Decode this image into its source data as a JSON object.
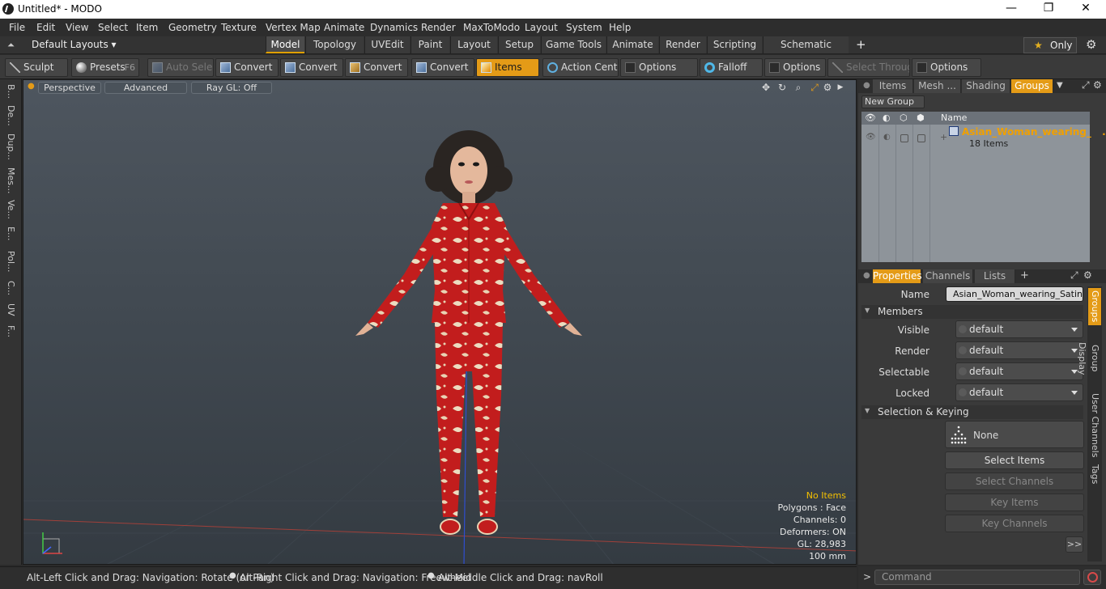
{
  "window": {
    "title": "Untitled* - MODO",
    "minimize": "—",
    "restore": "❐",
    "close": "✕"
  },
  "menu": [
    "File",
    "Edit",
    "View",
    "Select",
    "Item",
    "Geometry",
    "Texture",
    "Vertex Map",
    "Animate",
    "Dynamics",
    "Render",
    "MaxToModo",
    "Layout",
    "System",
    "Help"
  ],
  "layoutbar": {
    "layouts_label": "Default Layouts",
    "tabs": [
      "Model",
      "Topology",
      "UVEdit",
      "Paint",
      "Layout",
      "Setup",
      "Game Tools",
      "Animate",
      "Render",
      "Scripting",
      "Schematic Fusion"
    ],
    "active_tab": "Model",
    "add": "+",
    "only_label": "Only"
  },
  "toolbar": {
    "sculpt": "Sculpt",
    "presets": "Presets",
    "presets_key": "F6",
    "auto_select": "Auto Select",
    "convert": "Convert",
    "items": "Items",
    "action_center": "Action Center",
    "options": "Options",
    "falloff": "Falloff",
    "select_through": "Select Through"
  },
  "left_strip": [
    "B...",
    "De...",
    "Dup...",
    "Mes...",
    "Ve...",
    "E...",
    "Pol...",
    "C...",
    "UV",
    "F..."
  ],
  "viewport": {
    "perspective": "Perspective",
    "advanced": "Advanced",
    "raygl": "Ray GL: Off",
    "stats": {
      "no_items": "No Items",
      "polygons": "Polygons : Face",
      "channels": "Channels: 0",
      "deformers": "Deformers: ON",
      "gl": "GL: 28,983",
      "scale": "100 mm"
    }
  },
  "groups_panel": {
    "tabs": [
      "Items",
      "Mesh ...",
      "Shading",
      "Groups"
    ],
    "active_tab": "Groups",
    "new_group": "New Group",
    "name_col": "Name",
    "group_name": "Asian_Woman_wearing_ ...",
    "group_count": "18 Items"
  },
  "properties_panel": {
    "tabs": [
      "Properties",
      "Channels",
      "Lists"
    ],
    "active_tab": "Properties",
    "name_label": "Name",
    "name_value": "Asian_Woman_wearing_Satin_Pj",
    "members_header": "Members",
    "visible_label": "Visible",
    "render_label": "Render",
    "selectable_label": "Selectable",
    "locked_label": "Locked",
    "default_value": "default",
    "selection_header": "Selection & Keying",
    "none_label": "None",
    "select_items": "Select Items",
    "select_channels": "Select Channels",
    "key_items": "Key Items",
    "key_channels": "Key Channels",
    "more": ">>",
    "side_tabs": [
      "Groups",
      "Group Display",
      "User Channels",
      "Tags"
    ]
  },
  "statusbar": {
    "hint1": "Alt-Left Click and Drag: Navigation: Rotate (or Pan)",
    "hint2": "Alt-Right Click and Drag: Navigation: Freewheel",
    "hint3": "Alt-Middle Click and Drag: navRoll",
    "command_placeholder": "Command"
  },
  "colors": {
    "accent": "#e49b17",
    "pajama_red": "#c21d1d",
    "viewport_bg": "#4a525a"
  }
}
